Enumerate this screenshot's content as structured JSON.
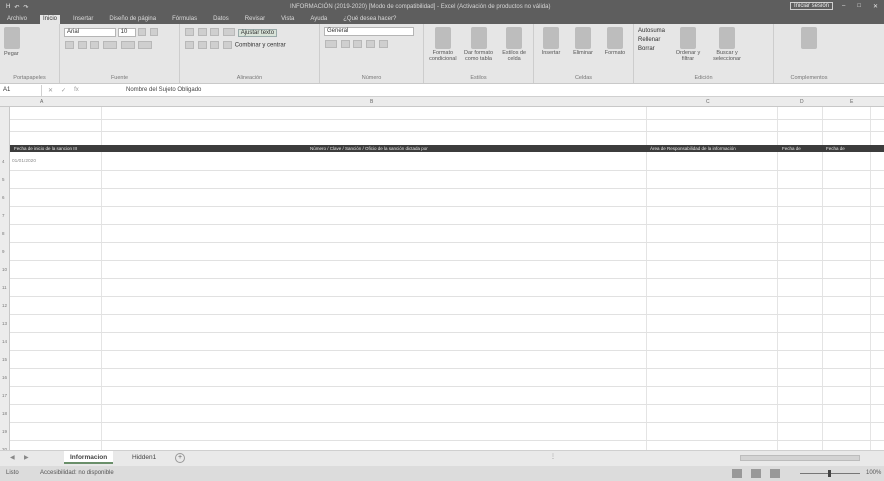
{
  "titlebar": {
    "qat": [
      "H",
      "↶",
      "↷"
    ],
    "title": "INFORMACIÓN (2019-2020) [Modo de compatibilidad] - Excel (Activación de productos no válida)",
    "signin": "Iniciar sesión"
  },
  "tabs": [
    "Archivo",
    "Inicio",
    "Insertar",
    "Diseño de página",
    "Fórmulas",
    "Datos",
    "Revisar",
    "Vista",
    "Ayuda",
    "¿Qué desea hacer?"
  ],
  "ribbon": {
    "paste": "Pegar",
    "clipboard": "Portapapeles",
    "font_name": "Arial",
    "font_size": "10",
    "font": "Fuente",
    "wrap": "Ajustar texto",
    "merge": "Combinar y centrar",
    "alignment": "Alineación",
    "number_format": "General",
    "number": "Número",
    "cond_format": "Formato condicional",
    "format_table": "Dar formato como tabla",
    "cell_styles": "Estilos de celda",
    "styles": "Estilos",
    "insert": "Insertar",
    "delete": "Eliminar",
    "format": "Formato",
    "cells": "Celdas",
    "autosum": "Autosuma",
    "fill": "Rellenar",
    "clear": "Borrar",
    "sort_filter": "Ordenar y filtrar",
    "find_select": "Buscar y seleccionar",
    "editing": "Edición",
    "addins": "Complementos"
  },
  "formula": {
    "name_box": "A1",
    "fx": "fx",
    "content": "Nombre del Sujeto Obligado"
  },
  "columns": [
    "A",
    "B",
    "C",
    "D",
    "E"
  ],
  "header_row": {
    "col1": "Fecha de inicio de la sancion III",
    "col2": "Número / Clave / Sanción / Oficio de la sanción dictada por",
    "col3": "Área de Responsabilidad de la información",
    "col4": "Fecha de",
    "col5": "Fecha de"
  },
  "rows": [
    {
      "n": "4",
      "a": "01/01/2020",
      "b": "",
      "c": "",
      "d": "",
      "e": ""
    },
    {
      "n": "5",
      "a": "",
      "b": "",
      "c": "",
      "d": "",
      "e": ""
    },
    {
      "n": "6",
      "a": "",
      "b": "",
      "c": "",
      "d": "",
      "e": ""
    },
    {
      "n": "7",
      "a": "",
      "b": "",
      "c": "",
      "d": "",
      "e": ""
    },
    {
      "n": "8",
      "a": "",
      "b": "",
      "c": "",
      "d": "",
      "e": ""
    },
    {
      "n": "9",
      "a": "",
      "b": "",
      "c": "",
      "d": "",
      "e": ""
    },
    {
      "n": "10",
      "a": "",
      "b": "",
      "c": "",
      "d": "",
      "e": ""
    },
    {
      "n": "11",
      "a": "",
      "b": "",
      "c": "",
      "d": "",
      "e": ""
    },
    {
      "n": "12",
      "a": "",
      "b": "",
      "c": "",
      "d": "",
      "e": ""
    },
    {
      "n": "13",
      "a": "",
      "b": "",
      "c": "",
      "d": "",
      "e": ""
    },
    {
      "n": "14",
      "a": "",
      "b": "",
      "c": "",
      "d": "",
      "e": ""
    },
    {
      "n": "15",
      "a": "",
      "b": "",
      "c": "",
      "d": "",
      "e": ""
    },
    {
      "n": "16",
      "a": "",
      "b": "",
      "c": "",
      "d": "",
      "e": ""
    },
    {
      "n": "17",
      "a": "",
      "b": "",
      "c": "",
      "d": "",
      "e": ""
    },
    {
      "n": "18",
      "a": "",
      "b": "",
      "c": "",
      "d": "",
      "e": ""
    },
    {
      "n": "19",
      "a": "",
      "b": "",
      "c": "",
      "d": "",
      "e": ""
    },
    {
      "n": "20",
      "a": "",
      "b": "",
      "c": "",
      "d": "",
      "e": ""
    }
  ],
  "sheet_tabs": [
    "Informacion",
    "Hidden1"
  ],
  "add_sheet": "+",
  "status": {
    "ready": "Listo",
    "accessibility": "Accesibilidad: no disponible",
    "zoom": "100%"
  }
}
